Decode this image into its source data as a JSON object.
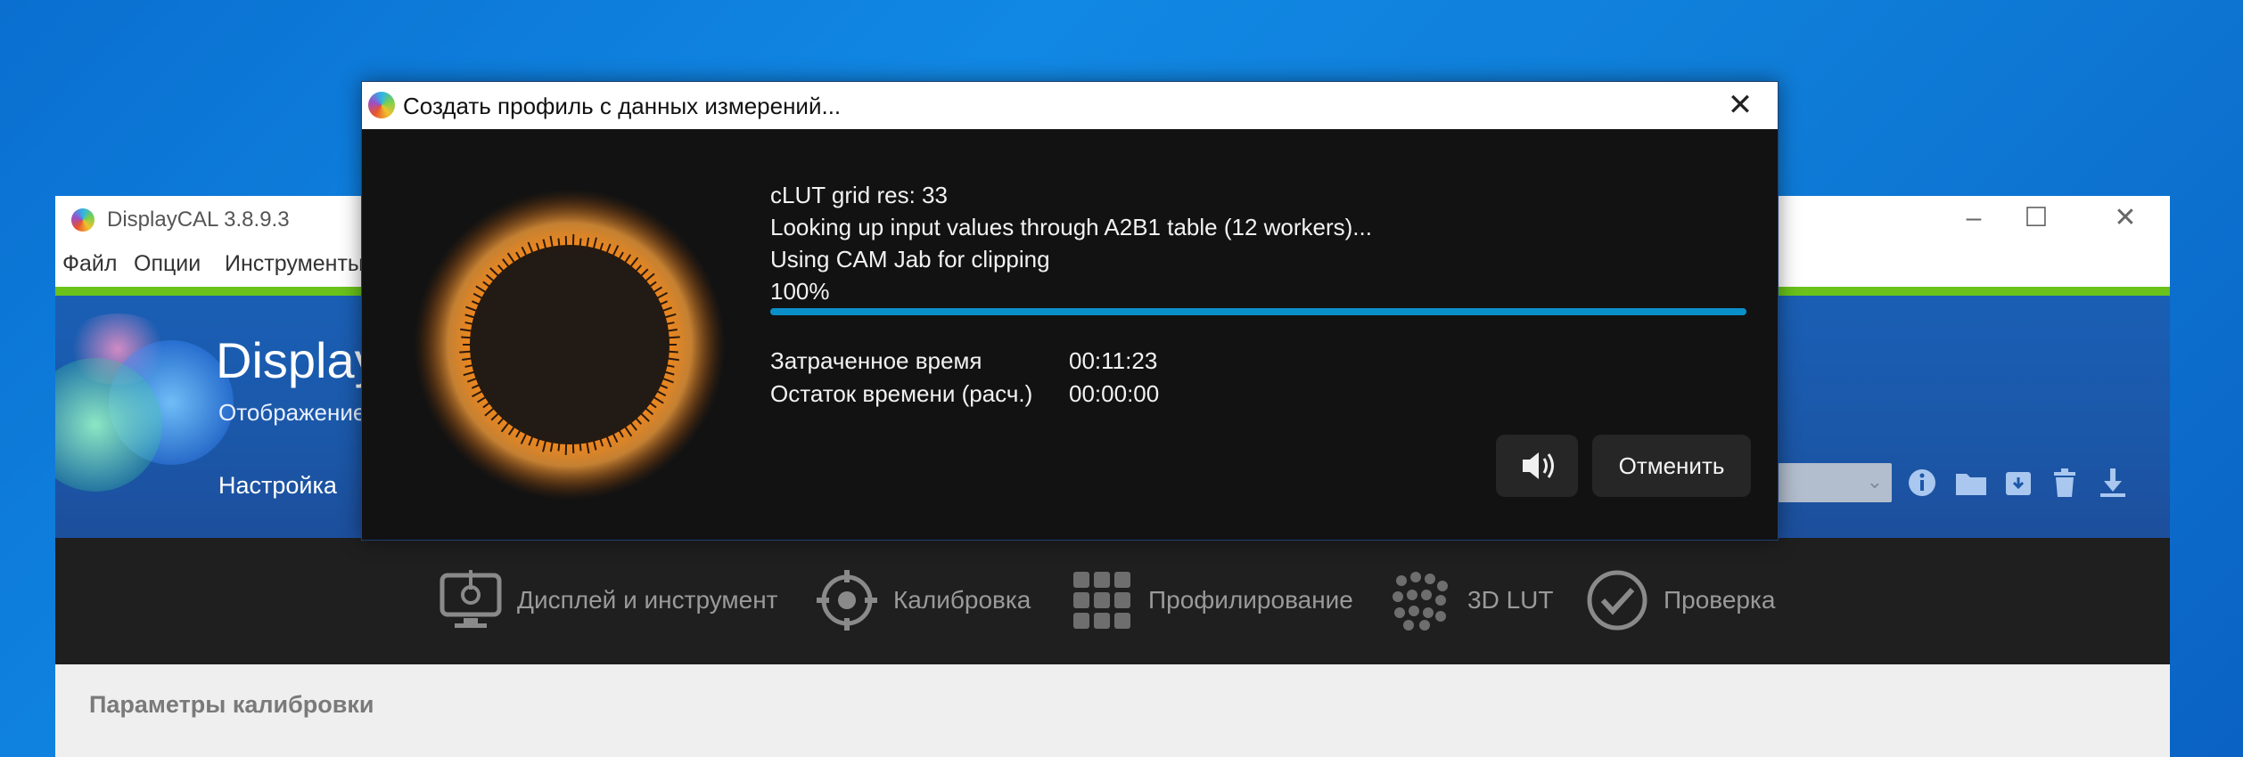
{
  "main_window": {
    "title": "DisplayCAL 3.8.9.3",
    "menu": [
      "Файл",
      "Опции",
      "Инструменты"
    ],
    "header": {
      "title": "DisplayCAL",
      "subtitle": "Отображение",
      "settings_label": "Настройка"
    },
    "nav": {
      "display_label": "Дисплей и инструмент",
      "calibration_label": "Калибровка",
      "profiling_label": "Профилирование",
      "lut3d_label": "3D LUT",
      "verify_label": "Проверка"
    },
    "section_title": "Параметры калибровки"
  },
  "dialog": {
    "title": "Создать профиль с данных измерений...",
    "status_lines": [
      "cLUT grid res: 33",
      "Looking up input values through A2B1 table (12 workers)...",
      "Using CAM Jab for clipping",
      "100%"
    ],
    "progress": 1.0,
    "elapsed_label": "Затраченное время",
    "elapsed_value": "00:11:23",
    "remaining_label": "Остаток времени (расч.)",
    "remaining_value": "00:00:00",
    "cancel_label": "Отменить"
  },
  "colors": {
    "desktop_blue": "#0f7ed9",
    "accent_green": "#6ac21b",
    "progress": "#0b8fc9",
    "spinner_orange": "#ff8c1a"
  },
  "icons": {
    "window_minimize": "minimize-icon",
    "window_maximize": "maximize-icon",
    "window_close": "close-icon",
    "header_icons": [
      "info-icon",
      "folder-icon",
      "archive-icon",
      "trash-icon",
      "download-icon"
    ],
    "sound": "speaker-icon"
  }
}
